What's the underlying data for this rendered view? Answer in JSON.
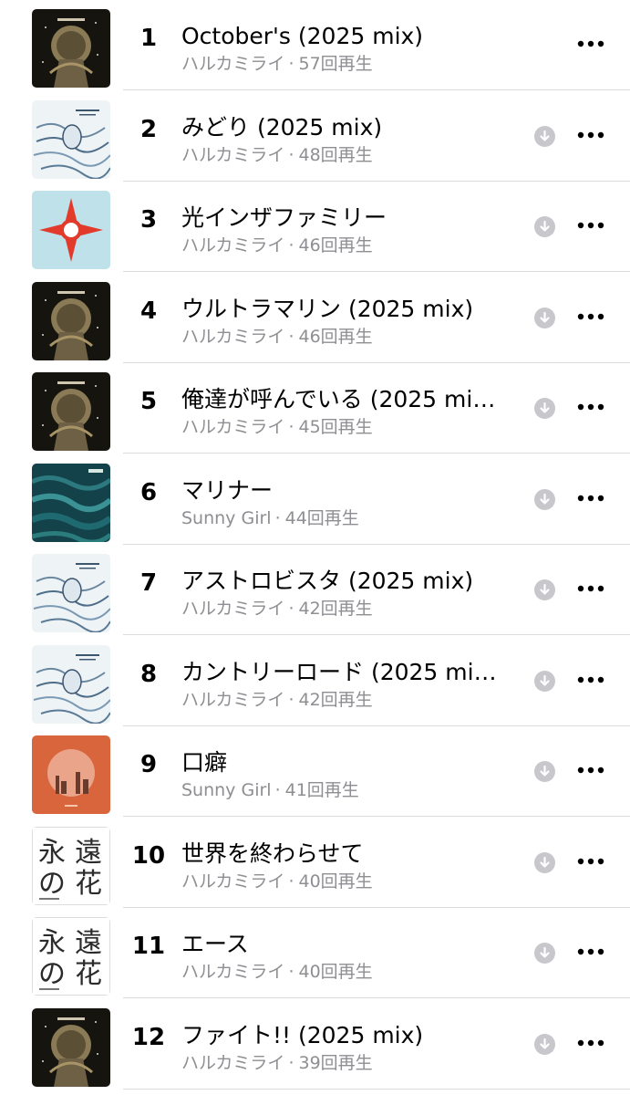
{
  "tracks": [
    {
      "rank": "1",
      "title": "October's (2025 mix)",
      "artist": "ハルカミライ",
      "plays": "57回再生",
      "download": false,
      "art": "cover-night-album"
    },
    {
      "rank": "2",
      "title": "みどり (2025 mix)",
      "artist": "ハルカミライ",
      "plays": "48回再生",
      "download": true,
      "art": "cover-white-sketch"
    },
    {
      "rank": "3",
      "title": "光インザファミリー",
      "artist": "ハルカミライ",
      "plays": "46回再生",
      "download": true,
      "art": "cover-compass"
    },
    {
      "rank": "4",
      "title": "ウルトラマリン (2025 mix)",
      "artist": "ハルカミライ",
      "plays": "46回再生",
      "download": true,
      "art": "cover-night-album"
    },
    {
      "rank": "5",
      "title": "俺達が呼んでいる (2025 mi…",
      "artist": "ハルカミライ",
      "plays": "45回再生",
      "download": true,
      "art": "cover-night-album"
    },
    {
      "rank": "6",
      "title": "マリナー",
      "artist": "Sunny Girl",
      "plays": "44回再生",
      "download": true,
      "art": "cover-teal-water"
    },
    {
      "rank": "7",
      "title": "アストロビスタ (2025 mix)",
      "artist": "ハルカミライ",
      "plays": "42回再生",
      "download": true,
      "art": "cover-white-sketch"
    },
    {
      "rank": "8",
      "title": "カントリーロード (2025 mi…",
      "artist": "ハルカミライ",
      "plays": "42回再生",
      "download": true,
      "art": "cover-white-sketch"
    },
    {
      "rank": "9",
      "title": "口癖",
      "artist": "Sunny Girl",
      "plays": "41回再生",
      "download": true,
      "art": "cover-orange-sunset"
    },
    {
      "rank": "10",
      "title": "世界を終わらせて",
      "artist": "ハルカミライ",
      "plays": "40回再生",
      "download": true,
      "art": "cover-eternal-flower"
    },
    {
      "rank": "11",
      "title": "エース",
      "artist": "ハルカミライ",
      "plays": "40回再生",
      "download": true,
      "art": "cover-eternal-flower"
    },
    {
      "rank": "12",
      "title": "ファイト!! (2025 mix)",
      "artist": "ハルカミライ",
      "plays": "39回再生",
      "download": true,
      "art": "cover-night-album"
    }
  ],
  "meta": {
    "separator": "·"
  },
  "art_text": {
    "eternal_flower": [
      "永",
      "遠",
      "の",
      "花"
    ]
  },
  "icons": {
    "download": "download-arrow-circle-icon",
    "more": "ellipsis-icon"
  },
  "colors": {
    "subtitle": "#8e8e93",
    "download_bg": "#c7c7cc",
    "separator": "#dcdcdf"
  }
}
